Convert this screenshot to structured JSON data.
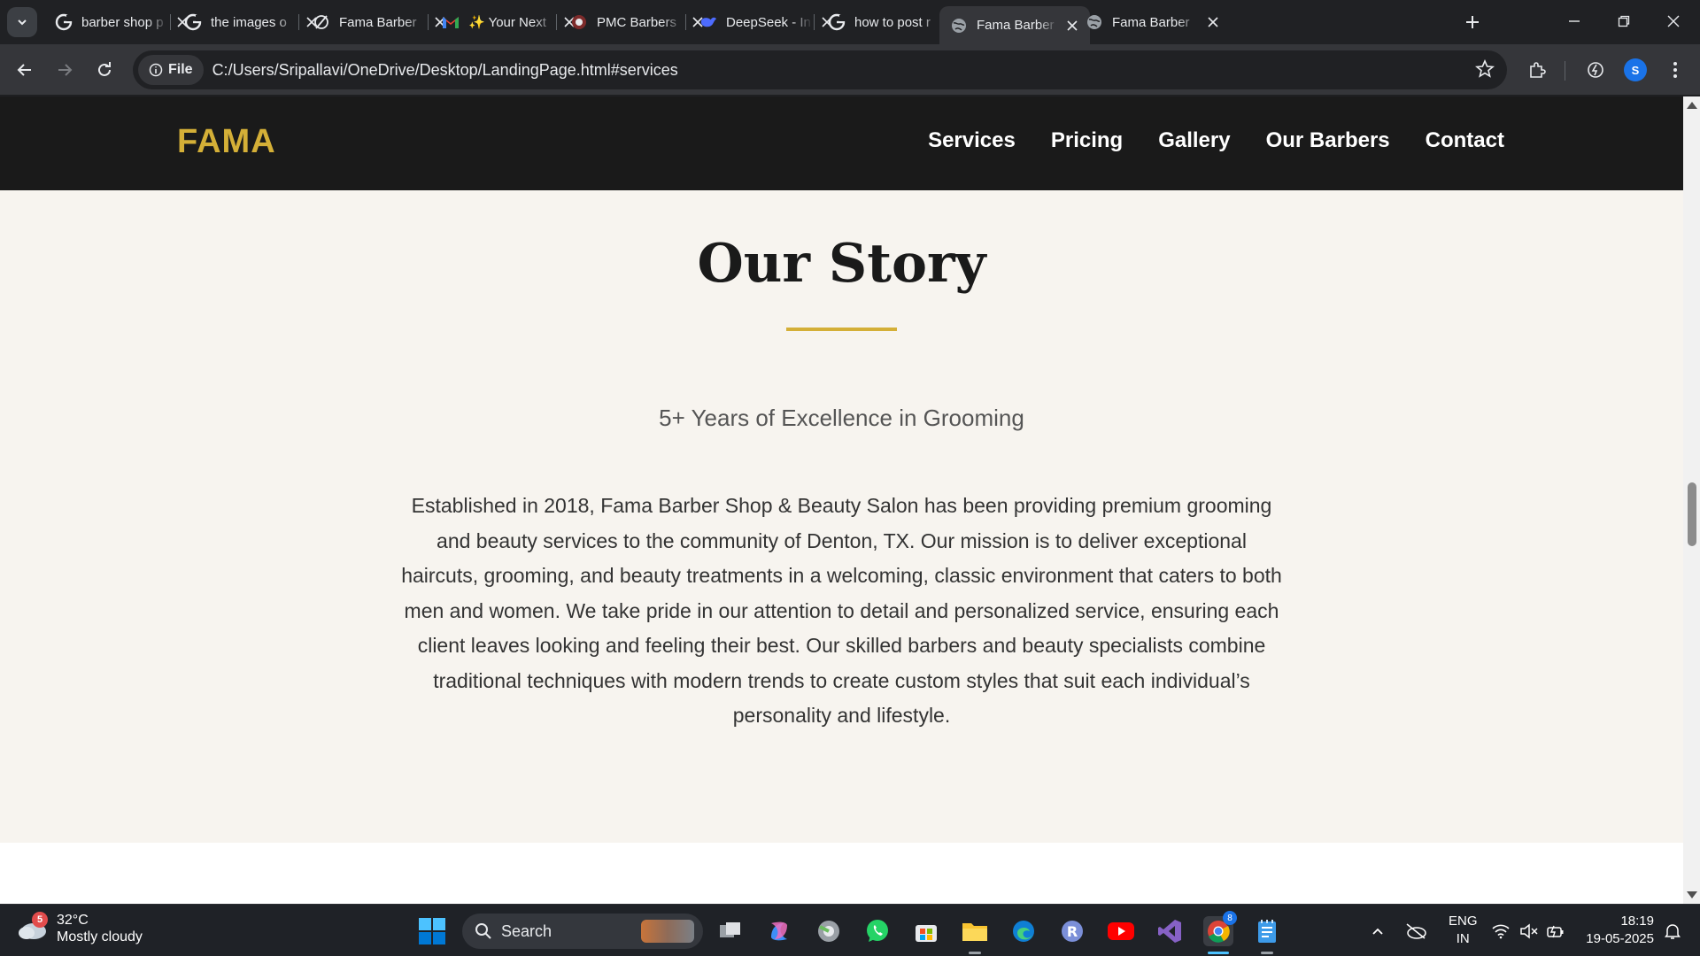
{
  "browser": {
    "tabs": [
      {
        "title": "barber shop p",
        "icon": "google-icon"
      },
      {
        "title": "the images o",
        "icon": "google-icon"
      },
      {
        "title": "Fama Barber",
        "icon": "perplexity-icon"
      },
      {
        "title": "✨ Your Next",
        "icon": "gmail-icon"
      },
      {
        "title": "PMC Barbers",
        "icon": "pmc-icon"
      },
      {
        "title": "DeepSeek - In",
        "icon": "deepseek-icon"
      },
      {
        "title": "how to post r",
        "icon": "google-icon"
      },
      {
        "title": "Fama Barber",
        "icon": "globe-icon",
        "active": true
      },
      {
        "title": "Fama Barber",
        "icon": "globe-icon"
      }
    ],
    "omnibox": {
      "chip_label": "File",
      "url": "C:/Users/Sripallavi/OneDrive/Desktop/LandingPage.html#services"
    },
    "profile_initial": "S"
  },
  "site": {
    "logo": "FAMA",
    "nav": [
      "Services",
      "Pricing",
      "Gallery",
      "Our Barbers",
      "Contact"
    ],
    "accent": "#d4af37",
    "story": {
      "title": "Our Story",
      "subtitle": "5+ Years of Excellence in Grooming",
      "body": "Established in 2018, Fama Barber Shop & Beauty Salon has been providing premium grooming and beauty services to the community of Denton, TX. Our mission is to deliver exceptional haircuts, grooming, and beauty treatments in a welcoming, classic environment that caters to both men and women. We take pride in our attention to detail and personalized service, ensuring each client leaves looking and feeling their best. Our skilled barbers and beauty specialists combine traditional techniques with modern trends to create custom styles that suit each individual’s personality and lifestyle."
    }
  },
  "taskbar": {
    "weather": {
      "badge": "5",
      "temp": "32°C",
      "condition": "Mostly cloudy"
    },
    "search_label": "Search",
    "lang": {
      "line1": "ENG",
      "line2": "IN"
    },
    "clock": {
      "time": "18:19",
      "date": "19-05-2025"
    },
    "chrome_badge": "8"
  }
}
